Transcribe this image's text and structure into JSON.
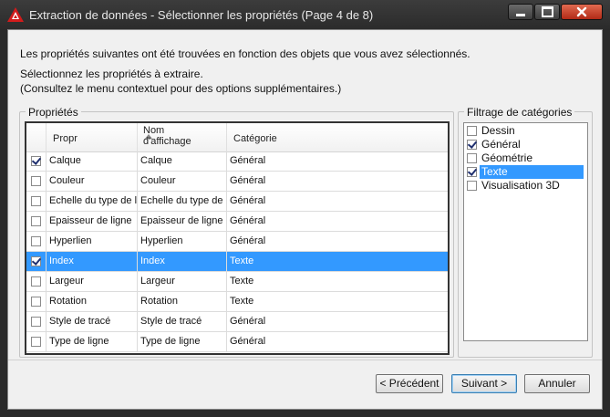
{
  "window": {
    "title": "Extraction de données - Sélectionner les propriétés (Page 4 de 8)",
    "app_icon": "autocad-logo-icon",
    "controls": [
      "minimize-icon",
      "maximize-icon",
      "close-icon"
    ]
  },
  "intro": {
    "line1": "Les propriétés suivantes ont été trouvées en fonction des objets que vous avez sélectionnés.",
    "line2": "Sélectionnez les propriétés à extraire.",
    "line3": "(Consultez le menu contextuel pour des options supplémentaires.)"
  },
  "properties": {
    "group_label": "Propriétés",
    "columns": {
      "prop": "Propr",
      "nom_line1": "Nom",
      "nom_line2": "d'affichage",
      "cat": "Catégorie"
    },
    "sort_column": "Propr",
    "rows": [
      {
        "prop": "Calque",
        "nom": "Calque",
        "cat": "Général",
        "checked": true,
        "selected": false
      },
      {
        "prop": "Couleur",
        "nom": "Couleur",
        "cat": "Général",
        "checked": false,
        "selected": false
      },
      {
        "prop": "Echelle du type de ligne",
        "nom": "Echelle du type de ligne",
        "cat": "Général",
        "checked": false,
        "selected": false
      },
      {
        "prop": "Epaisseur de ligne",
        "nom": "Epaisseur de ligne",
        "cat": "Général",
        "checked": false,
        "selected": false
      },
      {
        "prop": "Hyperlien",
        "nom": "Hyperlien",
        "cat": "Général",
        "checked": false,
        "selected": false
      },
      {
        "prop": "Index",
        "nom": "Index",
        "cat": "Texte",
        "checked": true,
        "selected": true
      },
      {
        "prop": "Largeur",
        "nom": "Largeur",
        "cat": "Texte",
        "checked": false,
        "selected": false
      },
      {
        "prop": "Rotation",
        "nom": "Rotation",
        "cat": "Texte",
        "checked": false,
        "selected": false
      },
      {
        "prop": "Style de tracé",
        "nom": "Style de tracé",
        "cat": "Général",
        "checked": false,
        "selected": false
      },
      {
        "prop": "Type de ligne",
        "nom": "Type de ligne",
        "cat": "Général",
        "checked": false,
        "selected": false
      }
    ]
  },
  "filter": {
    "group_label": "Filtrage de catégories",
    "items": [
      {
        "label": "Dessin",
        "checked": false,
        "selected": false
      },
      {
        "label": "Général",
        "checked": true,
        "selected": false
      },
      {
        "label": "Géométrie",
        "checked": false,
        "selected": false
      },
      {
        "label": "Texte",
        "checked": true,
        "selected": true
      },
      {
        "label": "Visualisation 3D",
        "checked": false,
        "selected": false
      }
    ]
  },
  "buttons": {
    "prev": "< Précédent",
    "next": "Suivant >",
    "cancel": "Annuler"
  },
  "colors": {
    "selection": "#3399ff",
    "title_bar": "#2b2b2b",
    "dialog_bg": "#f0f0f0",
    "close_button": "#c8391f"
  }
}
